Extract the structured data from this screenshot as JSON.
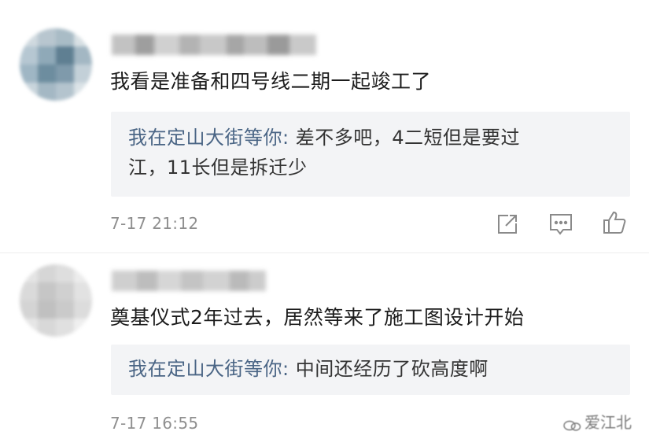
{
  "comments": [
    {
      "text": "我看是准备和四号线二期一起竣工了",
      "reply": {
        "author": "我在定山大街等你: ",
        "line1": "差不多吧，4二短但是要过",
        "line2": "江，11长但是拆迁少"
      },
      "timestamp": "7-17 21:12",
      "actions": [
        "share-icon",
        "comment-icon",
        "like-icon"
      ]
    },
    {
      "text": "奠基仪式2年过去，居然等来了施工图设计开始",
      "reply": {
        "author": "我在定山大街等你: ",
        "line1": "中间还经历了砍高度啊"
      },
      "timestamp": "7-17 16:55"
    }
  ],
  "watermark": {
    "icon": "wechat-icon",
    "text": "爱江北"
  }
}
